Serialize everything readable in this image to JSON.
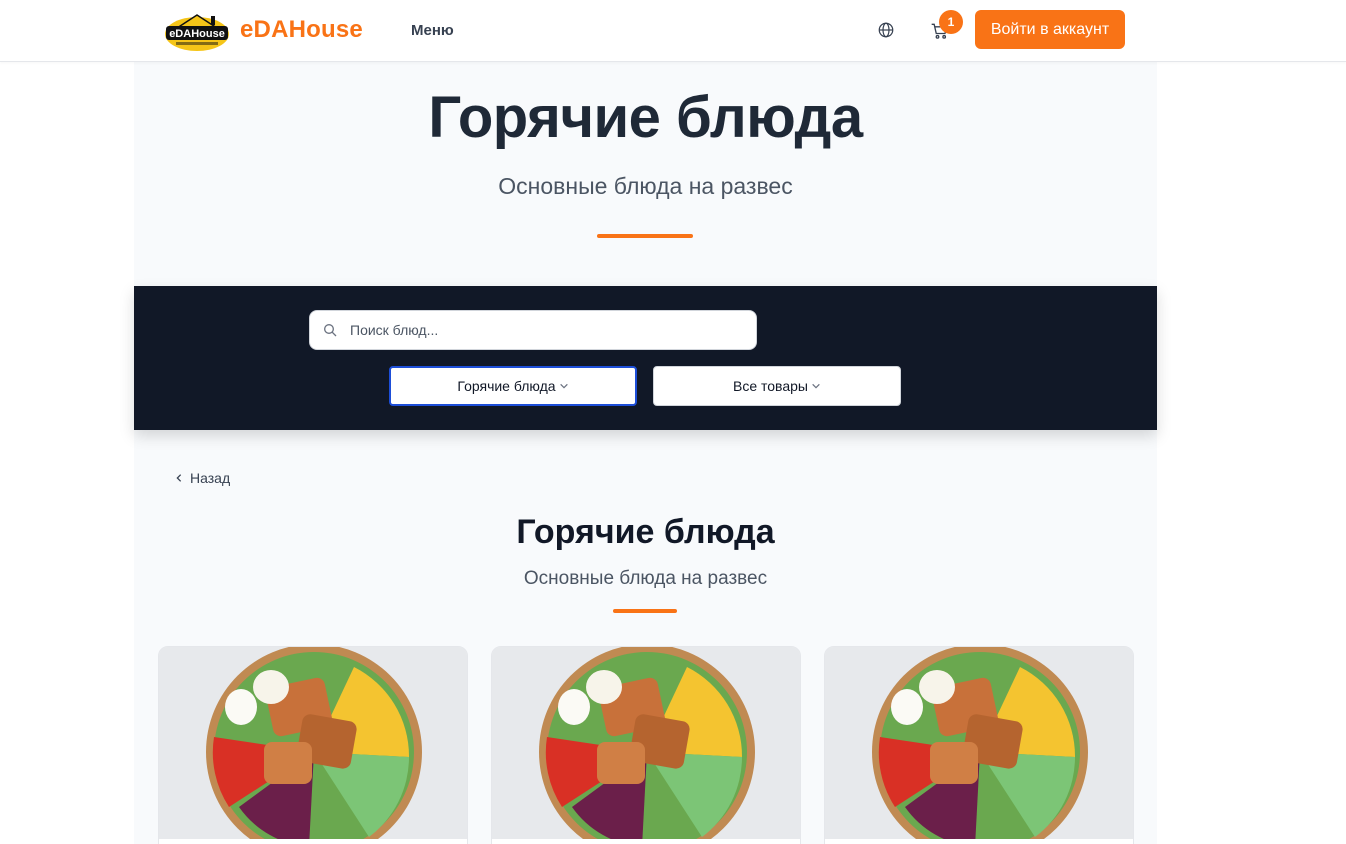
{
  "header": {
    "brand": "eDAHouse",
    "logo_text": "eDAHouse",
    "nav_menu": "Меню",
    "cart_count": "1",
    "login_label": "Войти в аккаунт",
    "icons": [
      "globe-icon",
      "cart-icon"
    ]
  },
  "hero": {
    "title": "Горячие блюда",
    "subtitle": "Основные блюда на развес"
  },
  "filters": {
    "search_placeholder": "Поиск блюд...",
    "search_value": "",
    "category_select": "Горячие блюда",
    "products_select": "Все товары"
  },
  "back_label": "Назад",
  "section": {
    "title": "Горячие блюда",
    "subtitle": "Основные блюда на развес"
  },
  "cards": [
    {
      "image": "salad-bowl"
    },
    {
      "image": "salad-bowl"
    },
    {
      "image": "salad-bowl"
    }
  ],
  "colors": {
    "accent": "#f97316",
    "dark_band": "#111827",
    "page_bg": "#f8fafc",
    "select_focus": "#1d4ed8"
  }
}
